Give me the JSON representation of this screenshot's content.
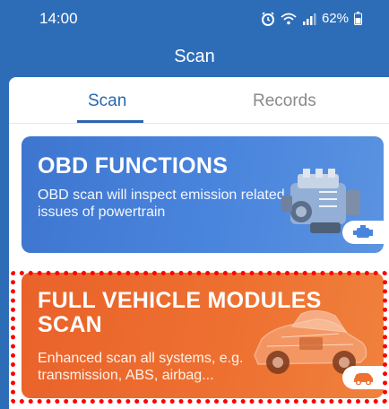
{
  "status_bar": {
    "time": "14:00",
    "battery": "62%",
    "icons": [
      "alarm-icon",
      "wifi-icon",
      "signal-icon",
      "battery-icon"
    ]
  },
  "app_bar": {
    "title": "Scan"
  },
  "tabs": [
    {
      "label": "Scan",
      "selected": true
    },
    {
      "label": "Records",
      "selected": false
    }
  ],
  "cards": [
    {
      "title": "OBD FUNCTIONS",
      "description": "OBD scan will inspect emission related issues of powertrain",
      "art": "engine-illustration",
      "badge_icon": "engine-icon",
      "color": "#4a85dd"
    },
    {
      "title": "FULL VEHICLE MODULES SCAN",
      "description": "Enhanced scan all systems, e.g. transmission, ABS, airbag...",
      "art": "car-illustration",
      "badge_icon": "car-icon",
      "color": "#ee7131"
    }
  ],
  "colors": {
    "primary": "#2d6db8",
    "tab_active": "#2a66b0",
    "highlight": "#ff0000"
  }
}
